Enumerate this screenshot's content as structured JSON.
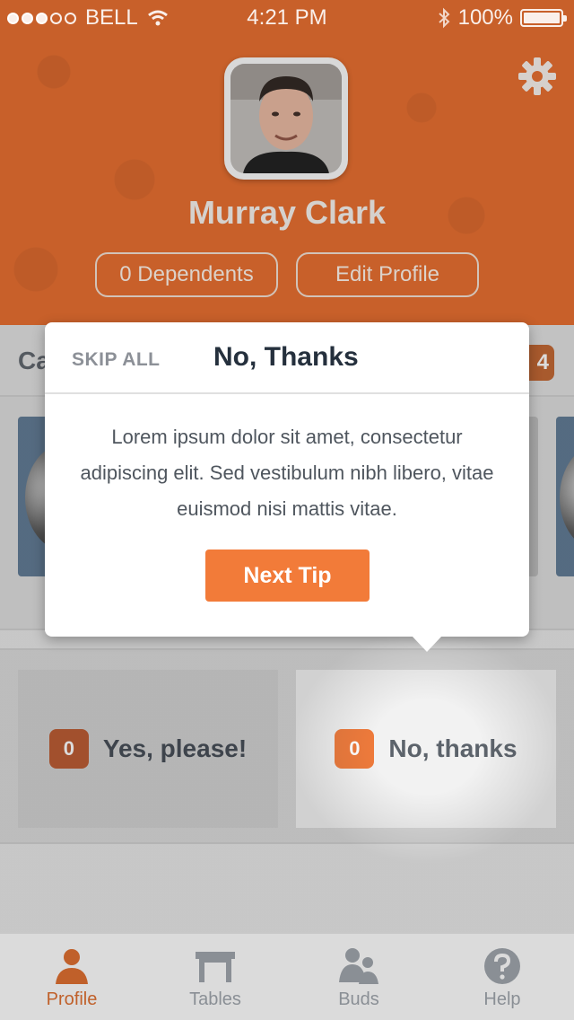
{
  "status_bar": {
    "carrier": "BELL",
    "signal_filled": 3,
    "signal_total": 5,
    "time": "4:21 PM",
    "battery": "100%"
  },
  "profile": {
    "name": "Murray Clark",
    "dependents_label": "0 Dependents",
    "edit_label": "Edit Profile"
  },
  "category": {
    "label": "Ca",
    "badge": "4"
  },
  "choices": {
    "yes": {
      "count": "0",
      "label": "Yes, please!"
    },
    "no": {
      "count": "0",
      "label": "No, thanks"
    }
  },
  "tip": {
    "skip_label": "SKIP ALL",
    "title": "No, Thanks",
    "body": "Lorem ipsum dolor sit amet, consectetur adipiscing elit. Sed vestibulum nibh libero, vitae euismod nisi mattis vitae.",
    "next_label": "Next Tip"
  },
  "tabs": [
    {
      "label": "Profile",
      "icon": "person-icon",
      "active": true
    },
    {
      "label": "Tables",
      "icon": "table-icon",
      "active": false
    },
    {
      "label": "Buds",
      "icon": "buddies-icon",
      "active": false
    },
    {
      "label": "Help",
      "icon": "help-icon",
      "active": false
    }
  ],
  "colors": {
    "header": "#c8602a",
    "accent": "#f27b39",
    "active_tab": "#c0602a"
  }
}
